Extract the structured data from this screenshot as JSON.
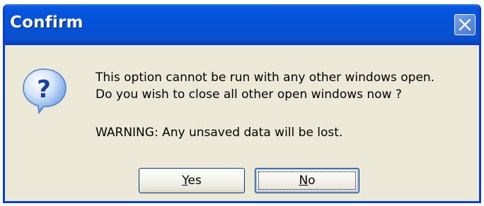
{
  "dialog": {
    "title": "Confirm",
    "message_line1": "This option cannot be run with any other windows open.",
    "message_line2": "Do you wish to close all other open windows now ?",
    "warning": "WARNING: Any unsaved data will be lost.",
    "icon": "question-icon"
  },
  "buttons": {
    "yes": {
      "mnemonic": "Y",
      "rest": "es"
    },
    "no": {
      "mnemonic": "N",
      "rest": "o"
    }
  },
  "colors": {
    "titlebar": "#0451d6",
    "dialog_bg": "#ece9d8",
    "button_border": "#003c74"
  }
}
